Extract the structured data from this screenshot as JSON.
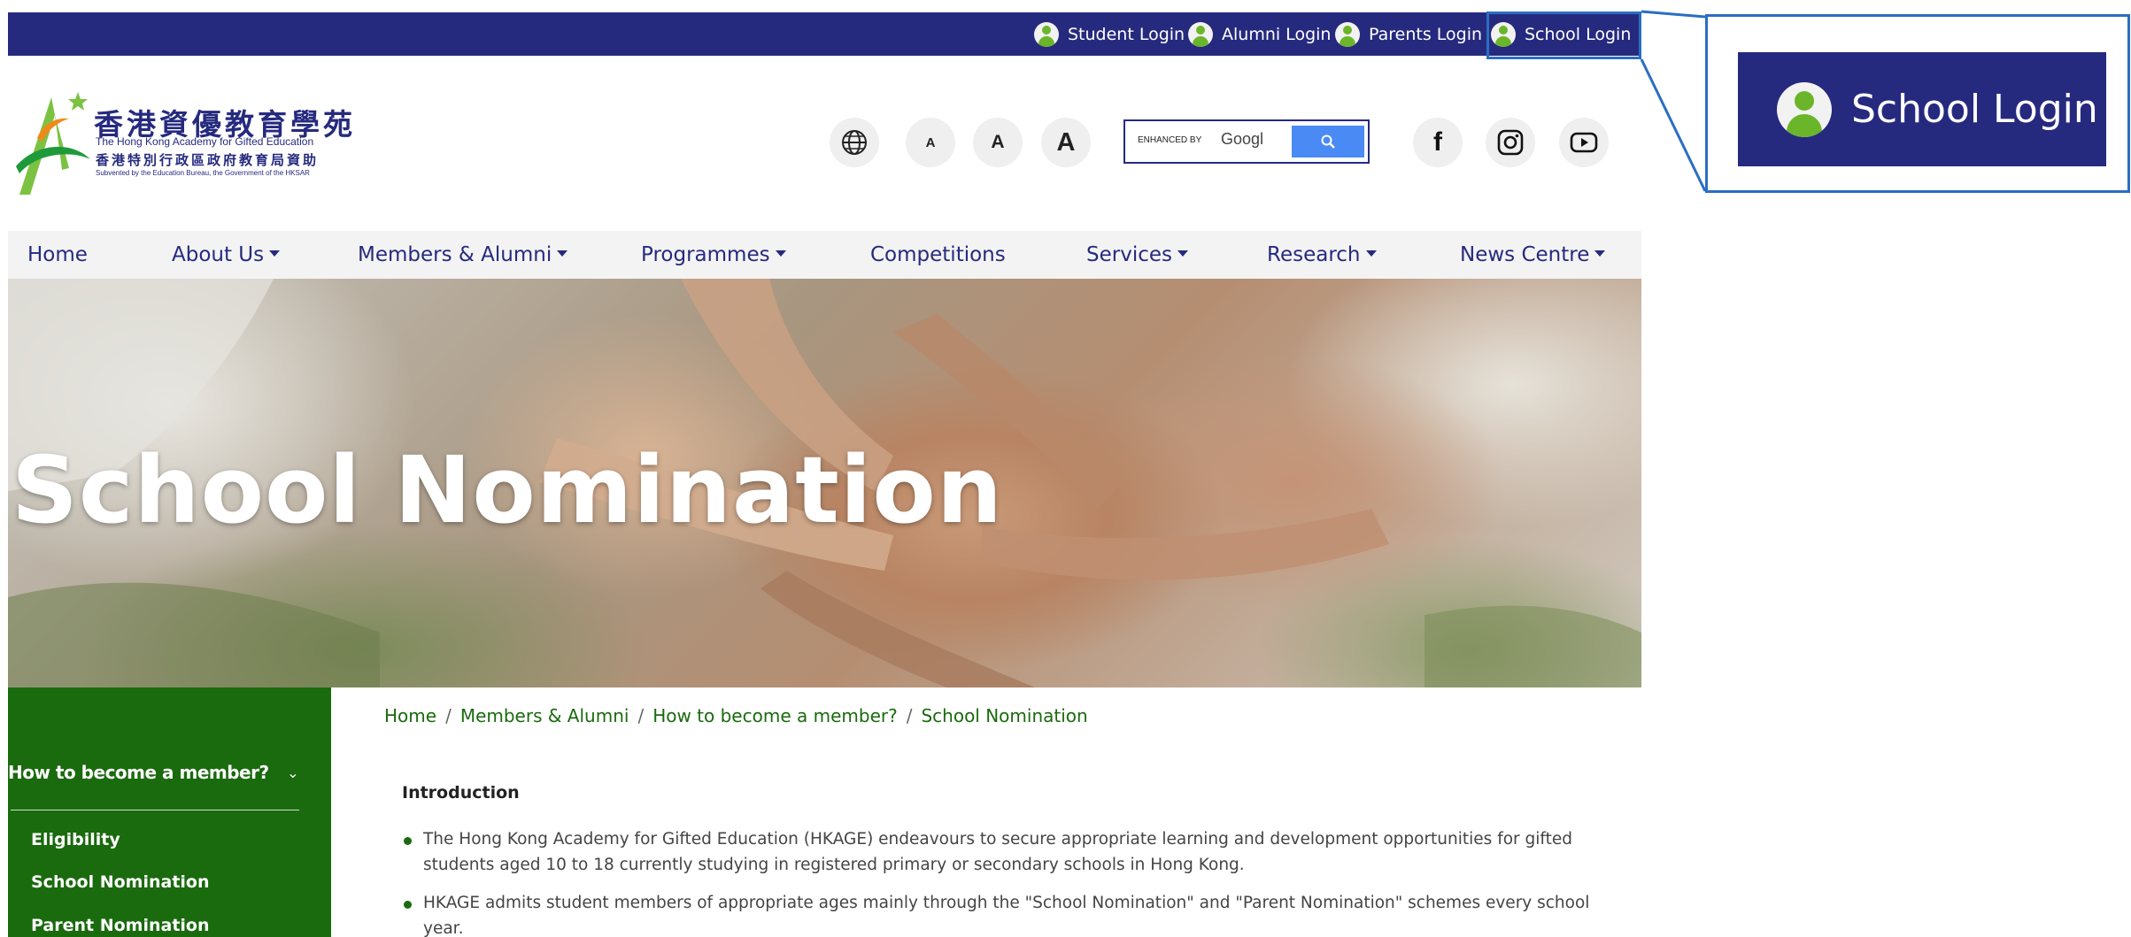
{
  "top_bar": {
    "logins": [
      {
        "label": "Student Login"
      },
      {
        "label": "Alumni Login"
      },
      {
        "label": "Parents Login"
      },
      {
        "label": "School Login"
      }
    ]
  },
  "callout": {
    "label": "School Login"
  },
  "logo": {
    "cn": "香港資優教育學苑",
    "en": "The Hong Kong Academy for Gifted Education",
    "cn_small": "香港特別行政區政府教育局資助",
    "sub": "Subvented by the Education Bureau, the Government of the HKSAR"
  },
  "header_tools": {
    "font_small": "A",
    "font_medium": "A",
    "font_large": "A",
    "search_enhanced": "ENHANCED BY",
    "search_brand": "Googl"
  },
  "nav": {
    "items": [
      {
        "label": "Home",
        "dropdown": false
      },
      {
        "label": "About Us",
        "dropdown": true
      },
      {
        "label": "Members & Alumni",
        "dropdown": true
      },
      {
        "label": "Programmes",
        "dropdown": true
      },
      {
        "label": "Competitions",
        "dropdown": false
      },
      {
        "label": "Services",
        "dropdown": true
      },
      {
        "label": "Research",
        "dropdown": true
      },
      {
        "label": "News Centre",
        "dropdown": true
      }
    ]
  },
  "hero": {
    "title": "School Nomination"
  },
  "sidebar": {
    "heading": "How to become a member?",
    "links": [
      "Eligibility",
      "School Nomination",
      "Parent Nomination"
    ]
  },
  "breadcrumb": [
    "Home",
    "Members & Alumni",
    "How to become a member?",
    "School Nomination"
  ],
  "content": {
    "intro_title": "Introduction",
    "bullets": [
      "The Hong Kong Academy for Gifted Education (HKAGE) endeavours to secure appropriate learning and development opportunities for gifted students aged 10 to 18 currently studying in registered primary or secondary schools in Hong Kong.",
      "HKAGE admits student members of appropriate ages mainly through the \"School Nomination\" and \"Parent Nomination\" schemes every school year."
    ]
  },
  "colors": {
    "brand_navy": "#262a7e",
    "brand_green": "#1a6a0e",
    "highlight_blue": "#2a6ec2",
    "search_blue": "#4a8af4"
  }
}
